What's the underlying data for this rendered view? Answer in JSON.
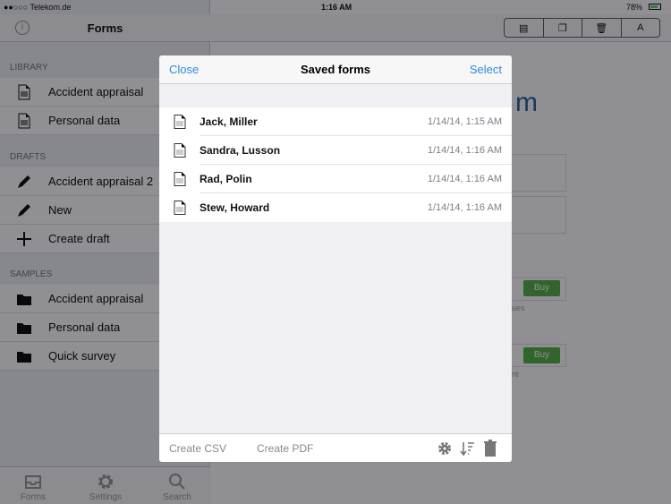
{
  "status_bar": {
    "carrier": "●●○○○ Telekom.de",
    "time": "1:16 AM",
    "battery": "78%"
  },
  "sidebar": {
    "title": "Forms",
    "sections": [
      {
        "header": "LIBRARY",
        "items": [
          {
            "label": "Accident appraisal",
            "icon": "document-icon"
          },
          {
            "label": "Personal data",
            "icon": "document-icon"
          }
        ]
      },
      {
        "header": "DRAFTS",
        "items": [
          {
            "label": "Accident appraisal 2",
            "icon": "pencil-icon"
          },
          {
            "label": "New",
            "icon": "pencil-icon"
          },
          {
            "label": "Create draft",
            "icon": "plus-icon"
          }
        ]
      },
      {
        "header": "SAMPLES",
        "items": [
          {
            "label": "Accident appraisal",
            "icon": "folder-icon"
          },
          {
            "label": "Personal data",
            "icon": "folder-icon"
          },
          {
            "label": "Quick survey",
            "icon": "folder-icon"
          }
        ]
      }
    ],
    "tabs": [
      {
        "label": "Forms",
        "icon": "inbox-icon"
      },
      {
        "label": "Settings",
        "icon": "gear-icon"
      },
      {
        "label": "Search",
        "icon": "search-icon"
      }
    ]
  },
  "toolbar": {
    "font_label": "A"
  },
  "background": {
    "heading_fragment": "m",
    "buy_label": "Buy",
    "fragment1": "ues",
    "fragment2": "nt"
  },
  "modal": {
    "title": "Saved forms",
    "close": "Close",
    "select": "Select",
    "rows": [
      {
        "name": "Jack, Miller",
        "date": "1/14/14, 1:15 AM"
      },
      {
        "name": "Sandra, Lusson",
        "date": "1/14/14, 1:16 AM"
      },
      {
        "name": "Rad, Polin",
        "date": "1/14/14, 1:16 AM"
      },
      {
        "name": "Stew, Howard",
        "date": "1/14/14, 1:16 AM"
      }
    ],
    "footer": {
      "csv": "Create CSV",
      "pdf": "Create PDF"
    }
  },
  "colors": {
    "accent": "#2c8ae8",
    "buy": "#4cae3c"
  }
}
